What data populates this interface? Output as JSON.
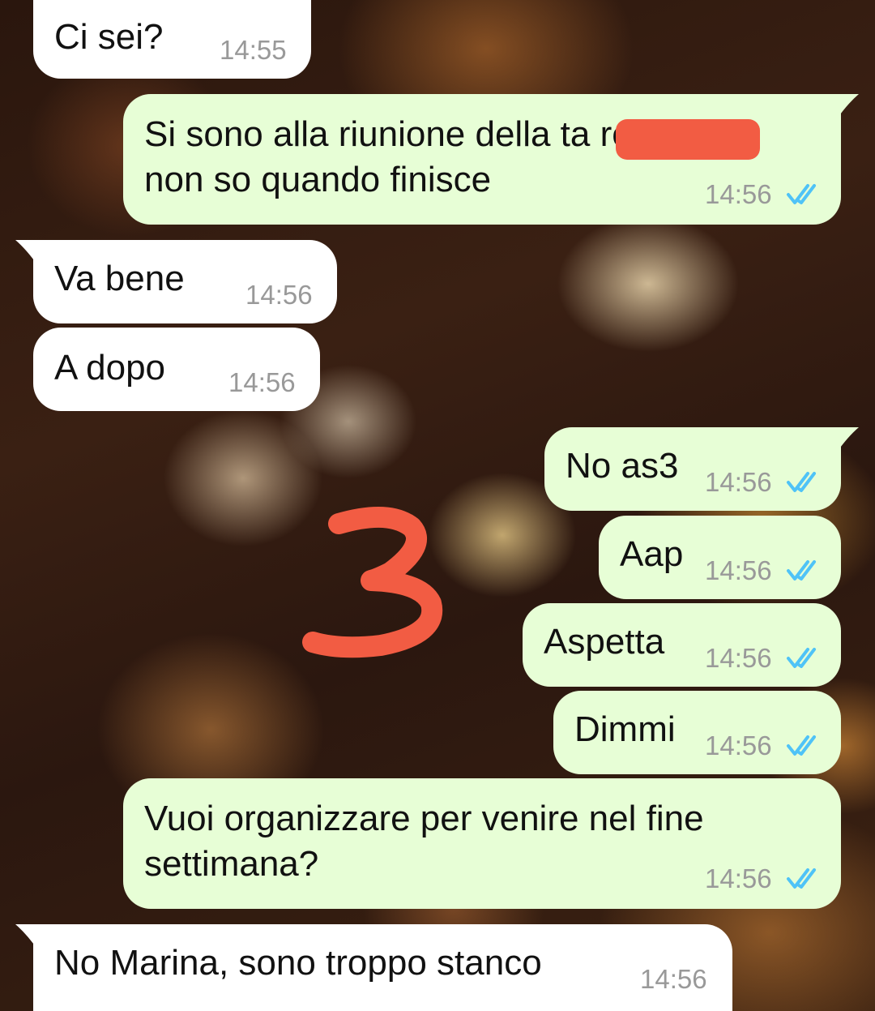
{
  "chat": {
    "messages": [
      {
        "direction": "in",
        "text": "Ci sei?",
        "time": "14:55"
      },
      {
        "direction": "out",
        "text": "Si sono alla riunione della ta          re e\nnon so quando finisce",
        "time": "14:56",
        "status": "read"
      },
      {
        "direction": "in",
        "text": "Va bene",
        "time": "14:56"
      },
      {
        "direction": "in",
        "text": "A dopo",
        "time": "14:56"
      },
      {
        "direction": "out",
        "text": "No as3",
        "time": "14:56",
        "status": "read"
      },
      {
        "direction": "out",
        "text": "Aap",
        "time": "14:56",
        "status": "read"
      },
      {
        "direction": "out",
        "text": "Aspetta",
        "time": "14:56",
        "status": "read"
      },
      {
        "direction": "out",
        "text": "Dimmi",
        "time": "14:56",
        "status": "read"
      },
      {
        "direction": "out",
        "text": "Vuoi organizzare per venire nel fine\nsettimana?",
        "time": "14:56",
        "status": "read"
      },
      {
        "direction": "in",
        "text": "No Marina, sono troppo stanco",
        "time": "14:56"
      }
    ]
  },
  "annotation": {
    "text": "3",
    "color": "#f25c43"
  },
  "colors": {
    "incoming_bubble": "#ffffff",
    "outgoing_bubble": "#e7fed6",
    "read_tick": "#4fc3f7",
    "redaction": "#f25c43"
  },
  "icons": {
    "read_status": "double-check-icon",
    "redaction": "redaction-mark"
  }
}
